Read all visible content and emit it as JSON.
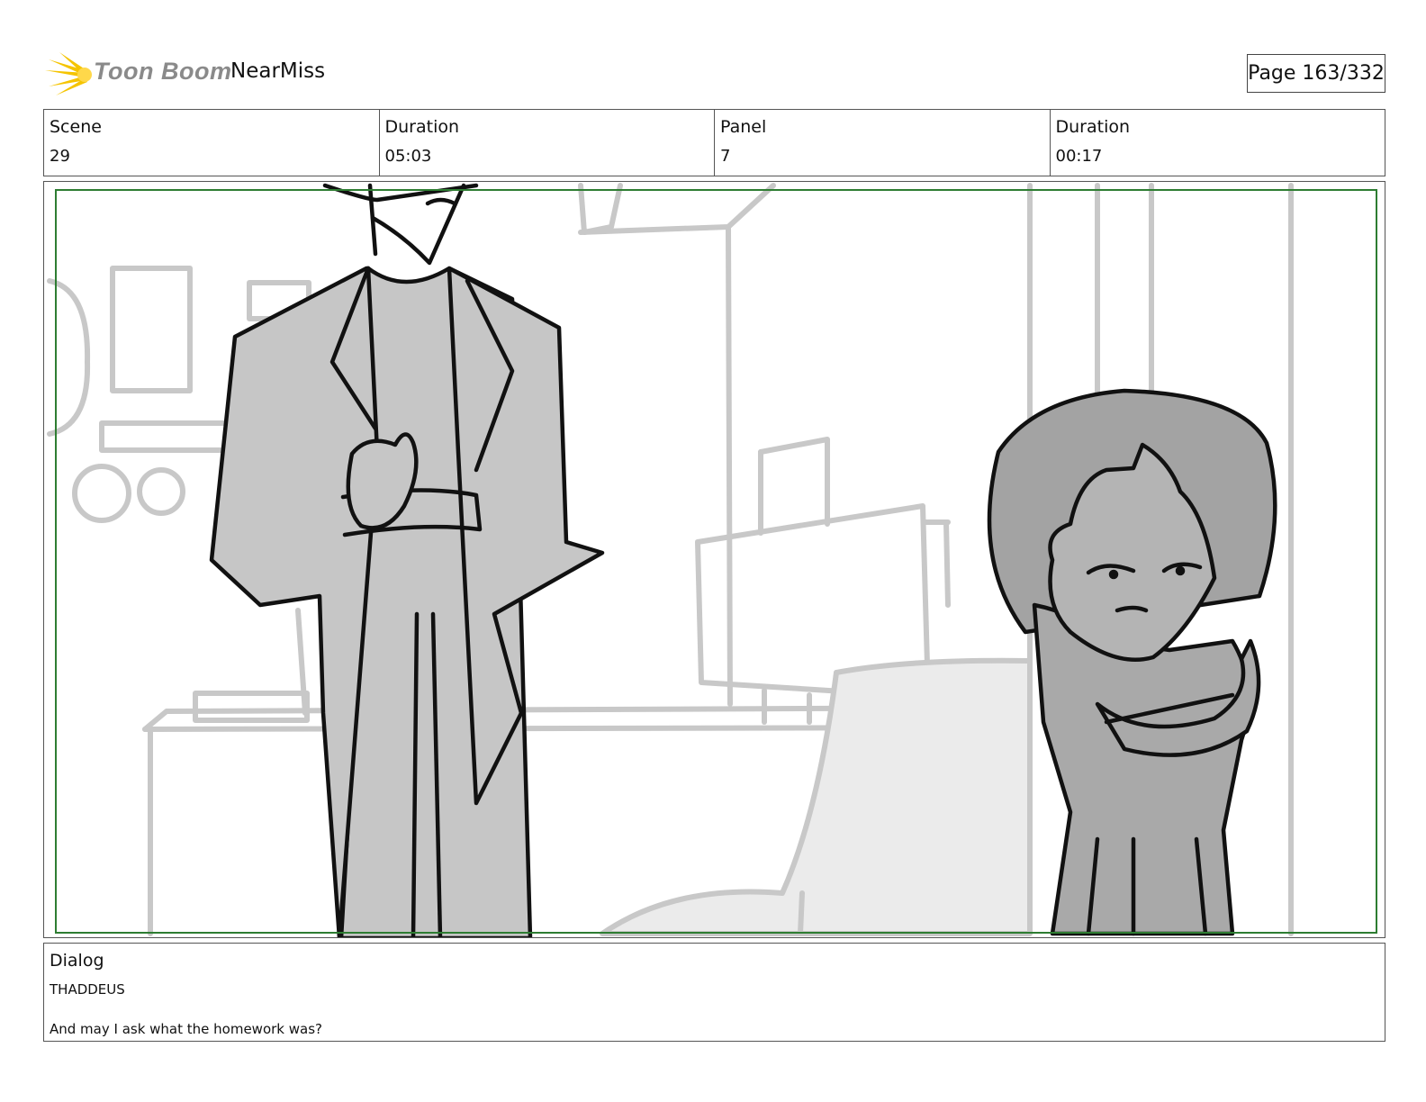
{
  "header": {
    "brand": "Toon Boom",
    "project_title": "NearMiss",
    "page_indicator": "Page 163/332",
    "brand_color": "#f5c400"
  },
  "info": {
    "scene_label": "Scene",
    "scene_value": "29",
    "scene_duration_label": "Duration",
    "scene_duration_value": "05:03",
    "panel_label": "Panel",
    "panel_value": "7",
    "panel_duration_label": "Duration",
    "panel_duration_value": "00:17"
  },
  "panel": {
    "safe_area_color": "#2e7d32"
  },
  "dialog": {
    "label": "Dialog",
    "speaker": "THADDEUS",
    "line": "And may I ask what the homework was?"
  }
}
